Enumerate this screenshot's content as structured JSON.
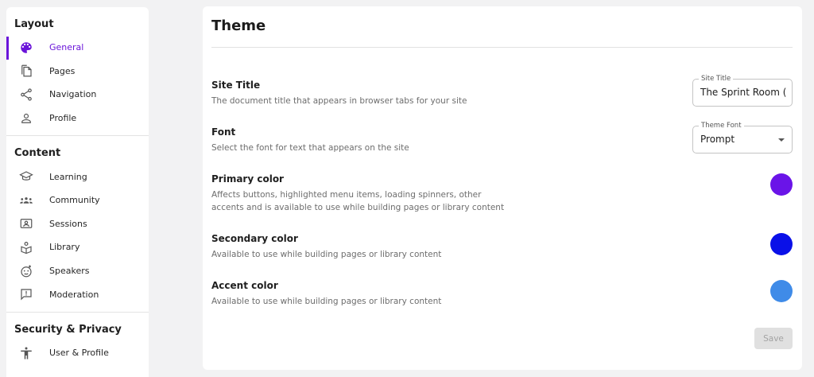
{
  "sidebar": {
    "sections": [
      {
        "title": "Layout",
        "items": [
          {
            "label": "General",
            "icon": "palette-icon",
            "active": true
          },
          {
            "label": "Pages",
            "icon": "pages-icon"
          },
          {
            "label": "Navigation",
            "icon": "share-icon"
          },
          {
            "label": "Profile",
            "icon": "person-icon"
          }
        ]
      },
      {
        "title": "Content",
        "items": [
          {
            "label": "Learning",
            "icon": "graduation-cap-icon"
          },
          {
            "label": "Community",
            "icon": "groups-icon"
          },
          {
            "label": "Sessions",
            "icon": "contact-card-icon"
          },
          {
            "label": "Library",
            "icon": "library-icon"
          },
          {
            "label": "Speakers",
            "icon": "face-icon"
          },
          {
            "label": "Moderation",
            "icon": "report-message-icon"
          }
        ]
      },
      {
        "title": "Security & Privacy",
        "items": [
          {
            "label": "User & Profile",
            "icon": "accessibility-icon"
          }
        ]
      }
    ],
    "accent_color": "#6a14d9"
  },
  "main": {
    "title": "Theme",
    "site_title": {
      "title": "Site Title",
      "description": "The document title that appears in browser tabs for your site",
      "field_label": "Site Title",
      "value": "The Sprint Room (Co"
    },
    "font": {
      "title": "Font",
      "description": "Select the font for text that appears on the site",
      "field_label": "Theme Font",
      "value": "Prompt"
    },
    "primary_color": {
      "title": "Primary color",
      "description": "Affects buttons, highlighted menu items, loading spinners, other accents and is available to use while building pages or library content",
      "color": "#6a14e8"
    },
    "secondary_color": {
      "title": "Secondary color",
      "description": "Available to use while building pages or library content",
      "color": "#0a10e8"
    },
    "accent_color": {
      "title": "Accent color",
      "description": "Available to use while building pages or library content",
      "color": "#3f8be8"
    },
    "save_label": "Save"
  }
}
